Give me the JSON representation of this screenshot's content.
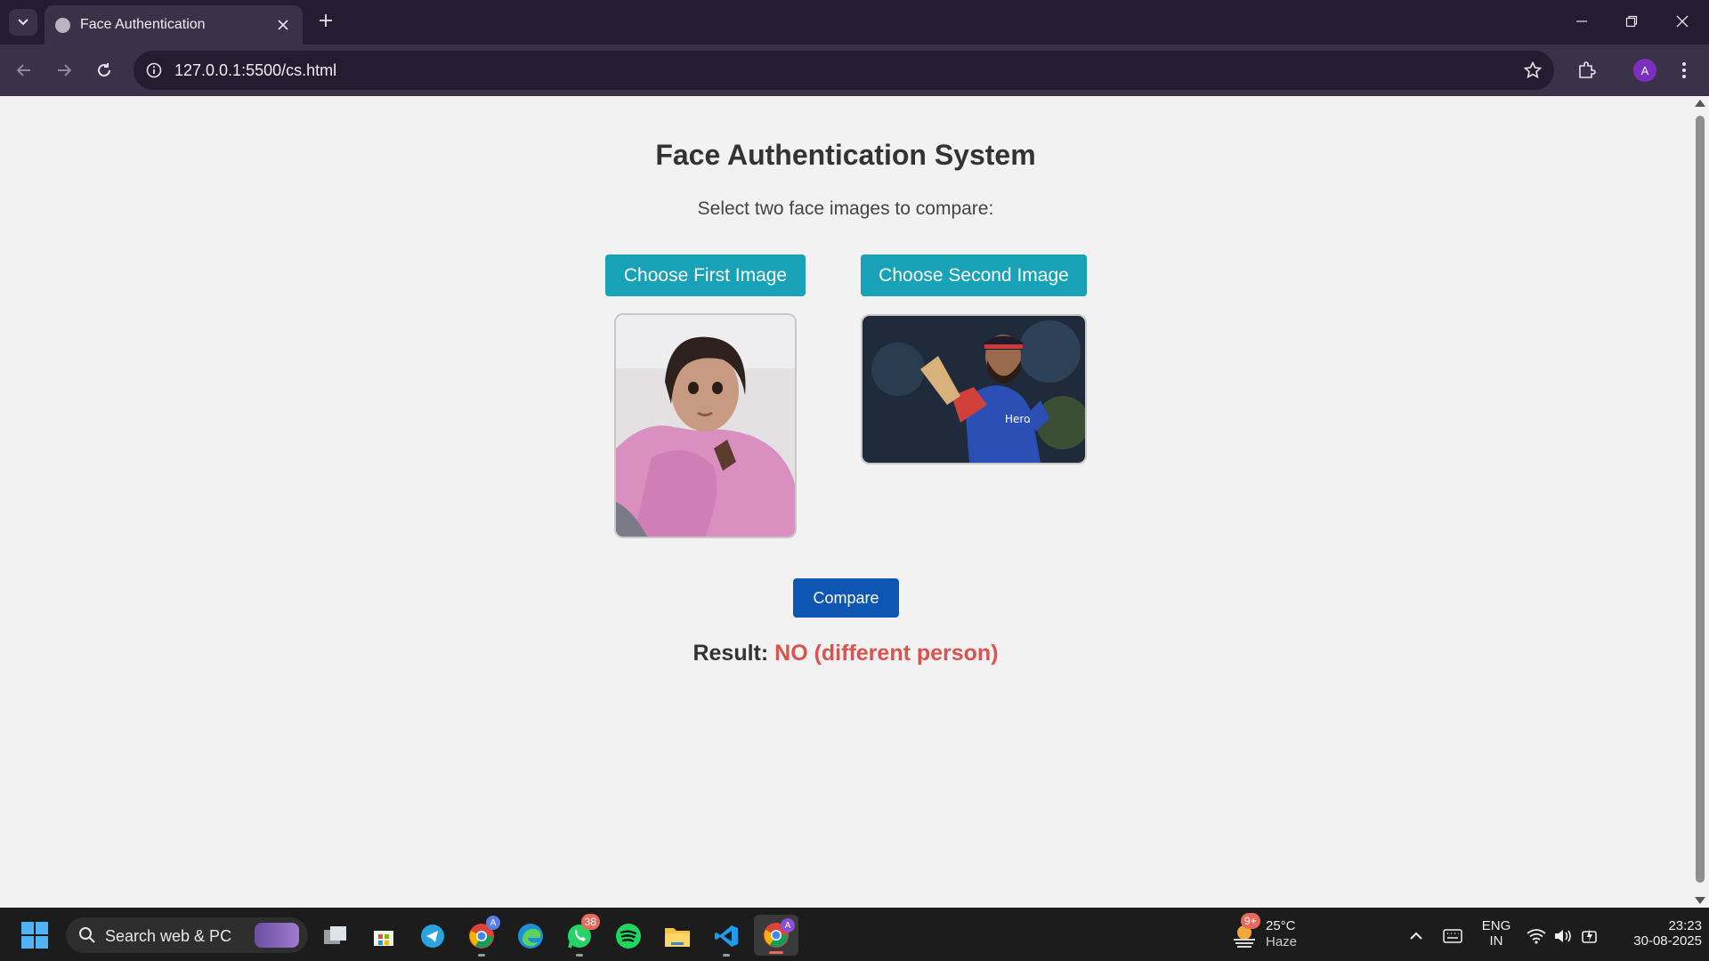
{
  "browser": {
    "tab_title": "Face Authentication",
    "url": "127.0.0.1:5500/cs.html",
    "profile_initial": "A"
  },
  "page": {
    "title": "Face Authentication System",
    "subtitle": "Select two face images to compare:",
    "choose_first_label": "Choose First Image",
    "choose_second_label": "Choose Second Image",
    "compare_label": "Compare",
    "result_label": "Result:",
    "result_value": "NO (different person)"
  },
  "taskbar": {
    "search_text": "Search web & PC",
    "whatsapp_badge": "38",
    "chrome_badge": "A",
    "weather_badge": "9+",
    "weather_temp": "25°C",
    "weather_desc": "Haze",
    "lang_top": "ENG",
    "lang_bottom": "IN",
    "time": "23:23",
    "date": "30-08-2025"
  },
  "colors": {
    "choose_button": "#17a2b8",
    "compare_button": "#0d56b1",
    "result_negative": "#d9534f"
  }
}
